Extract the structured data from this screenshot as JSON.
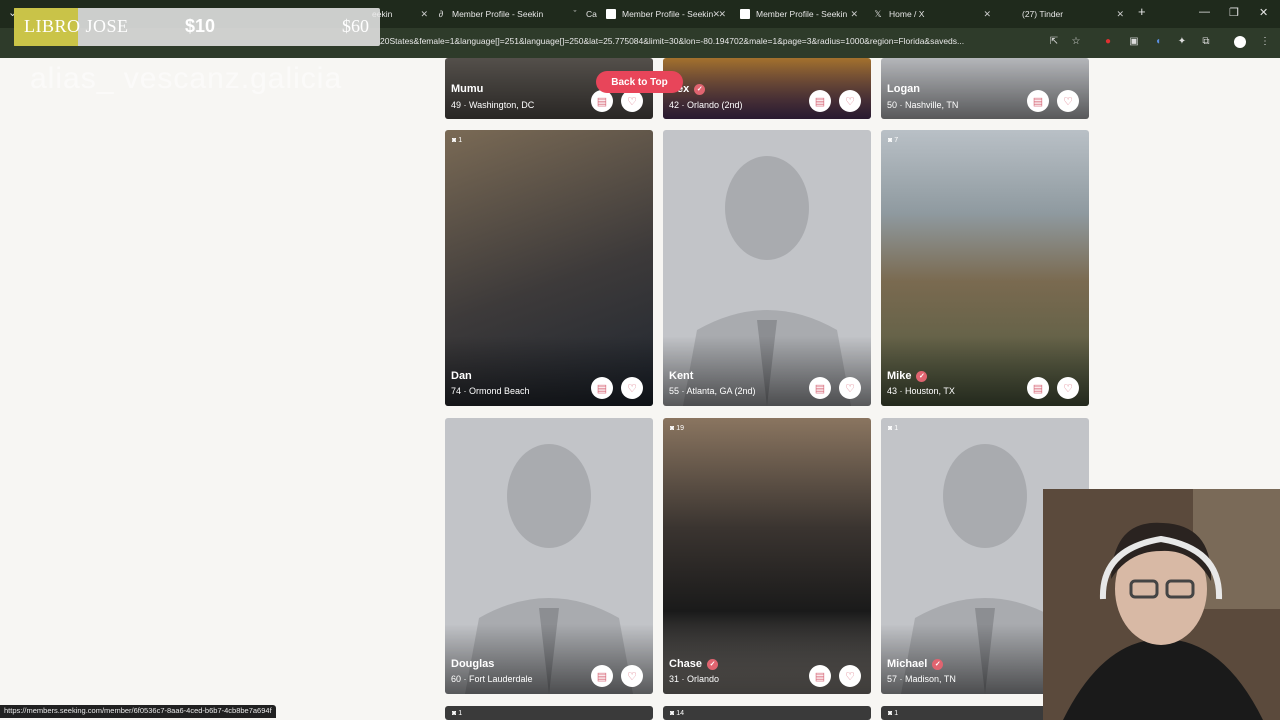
{
  "overlay": {
    "banner_left": "LIBRO JOSE",
    "banner_mid": "$10",
    "banner_right": "$60",
    "alias": "alias_ vescanz.galicia"
  },
  "tabs": [
    {
      "title": "eekin",
      "favicon": "page-icon"
    },
    {
      "title": "Member Profile - Seekin",
      "favicon": "page-icon"
    },
    {
      "title": "Ca",
      "favicon": "page-icon"
    },
    {
      "title": "Member Profile - Seekin",
      "favicon": "white-page-icon"
    },
    {
      "title": "Member Profile - Seekin",
      "favicon": "white-page-icon"
    },
    {
      "title": "Home / X",
      "favicon": "x-icon"
    },
    {
      "title": "(27) Tinder",
      "favicon": "tinder-icon"
    }
  ],
  "new_tab": "+",
  "address": {
    "url": "20States&female=1&language[]=251&language[]=250&lat=25.775084&limit=30&lon=-80.194702&male=1&page=3&radius=1000&region=Florida&saveds..."
  },
  "back_to_top": "Back to Top",
  "row1": [
    {
      "name": "Mumu",
      "meta": "49 · Washington, DC",
      "verified": false
    },
    {
      "name": "ex",
      "meta": "42 · Orlando (2nd)",
      "verified": true
    },
    {
      "name": "Logan",
      "meta": "50 · Nashville, TN",
      "verified": false
    }
  ],
  "row2": [
    {
      "name": "Dan",
      "meta": "74 · Ormond Beach",
      "verified": false,
      "photos": "1"
    },
    {
      "name": "Kent",
      "meta": "55 · Atlanta, GA (2nd)",
      "verified": false
    },
    {
      "name": "Mike",
      "meta": "43 · Houston, TX",
      "verified": true,
      "photos": "7"
    }
  ],
  "row3": [
    {
      "name": "Douglas",
      "meta": "60 · Fort Lauderdale",
      "verified": false
    },
    {
      "name": "Chase",
      "meta": "31 · Orlando",
      "verified": true,
      "photos": "19"
    },
    {
      "name": "Michael",
      "meta": "57 · Madison, TN",
      "verified": true,
      "photos": "1"
    }
  ],
  "row4": [
    {
      "photos": "1"
    },
    {
      "photos": "14"
    },
    {
      "photos": "1"
    }
  ],
  "status_bar": "https://members.seeking.com/member/6f0536c7-8aa6-4ced-b6b7-4cb8be7a694f",
  "icons": {
    "message": "message-icon",
    "like": "heart-icon",
    "verified": "verified-check-icon",
    "camera": "camera-icon"
  }
}
